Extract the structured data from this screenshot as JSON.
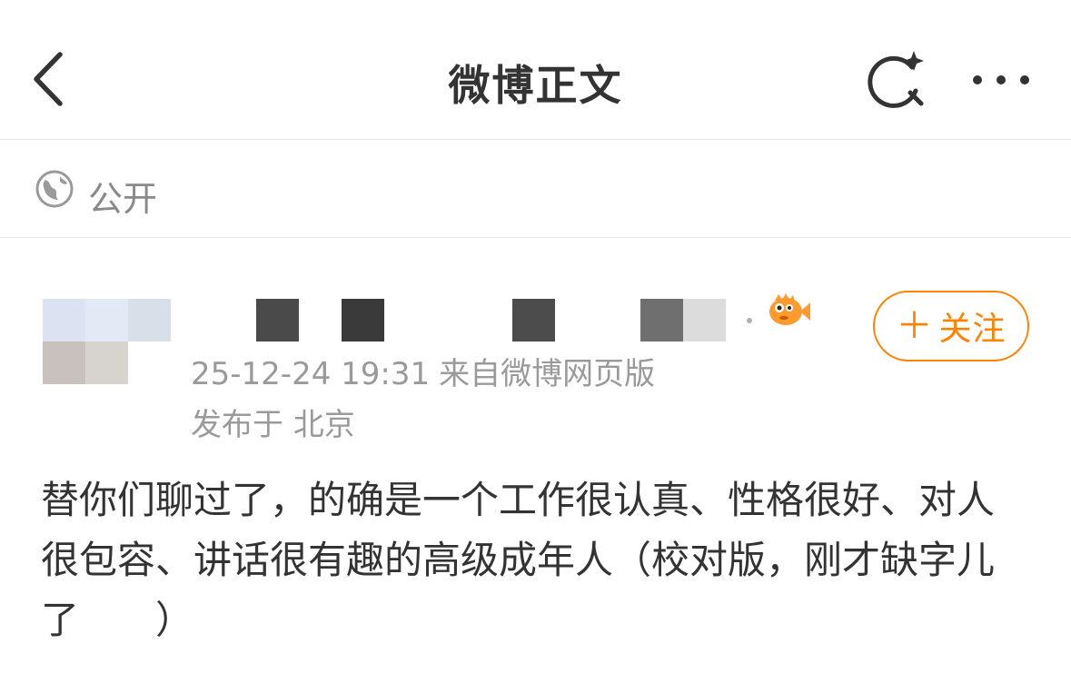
{
  "header": {
    "title": "微博正文",
    "back_icon": "chevron-left-icon",
    "search_icon": "search-sparkle-icon",
    "more_icon": "more-horizontal-icon"
  },
  "visibility": {
    "icon": "globe-icon",
    "label": "公开"
  },
  "author": {
    "avatar": "pixelated-avatar",
    "name_obscured": true,
    "badge_icon": "fish-badge-icon",
    "follow_label": "关注",
    "follow_plus": "＋"
  },
  "meta": {
    "time": "25-12-24 19:31",
    "source": "来自微博网页版",
    "location": "发布于 北京"
  },
  "post": {
    "text": "替你们聊过了，的确是一个工作很认真、性格很好、对人很包容、讲话很有趣的高级成年人（校对版，刚才缺字儿了　　）"
  },
  "colors": {
    "accent": "#ff8200",
    "text": "#333333",
    "muted": "#9a9a9a",
    "divider": "#e6e6e6"
  }
}
